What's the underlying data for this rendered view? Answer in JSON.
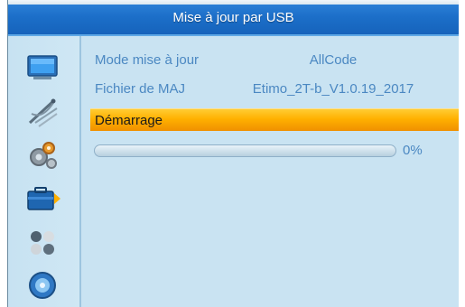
{
  "header": {
    "title": "Mise à jour par USB"
  },
  "sidebar": {
    "items": [
      {
        "icon": "tv-icon"
      },
      {
        "icon": "satellite-dish-icon"
      },
      {
        "icon": "gears-icon"
      },
      {
        "icon": "toolbox-icon",
        "selected": true
      },
      {
        "icon": "balls-icon"
      },
      {
        "icon": "media-disc-icon"
      }
    ]
  },
  "settings": {
    "mode_label": "Mode mise à jour",
    "mode_value": "AllCode",
    "file_label": "Fichier de MAJ",
    "file_value": "Etimo_2T-b_V1.0.19_2017",
    "start_label": "Démarrage"
  },
  "progress": {
    "value": 0,
    "text": "0%"
  },
  "colors": {
    "title_bar": "#1c6fc9",
    "background": "#c9e3f2",
    "text": "#4b88c2",
    "highlight": "#ffb000"
  }
}
